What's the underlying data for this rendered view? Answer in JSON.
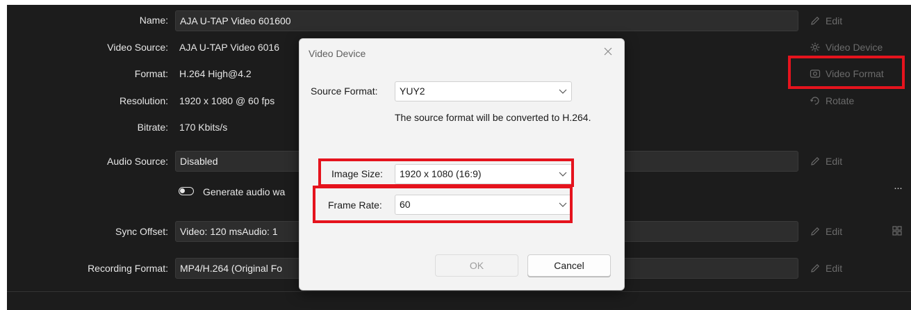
{
  "settings": {
    "name": {
      "label": "Name:",
      "value": "AJA U-TAP Video 601600"
    },
    "video_source": {
      "label": "Video Source:",
      "value": "AJA U-TAP Video 6016"
    },
    "format": {
      "label": "Format:",
      "value": "H.264 High@4.2"
    },
    "resolution": {
      "label": "Resolution:",
      "value": "1920 x 1080 @ 60 fps"
    },
    "bitrate": {
      "label": "Bitrate:",
      "value": "170 Kbits/s"
    },
    "audio_source": {
      "label": "Audio Source:",
      "value": "Disabled"
    },
    "generate_audio": {
      "label": "Generate audio wa"
    },
    "sync_offset": {
      "label": "Sync Offset:",
      "value": "Video: 120 msAudio: 1"
    },
    "recording_format": {
      "label": "Recording Format:",
      "value": "MP4/H.264 (Original Fo"
    }
  },
  "actions": {
    "edit": "Edit",
    "video_device": "Video Device",
    "video_format": "Video Format",
    "rotate": "Rotate",
    "more": "···"
  },
  "dialog": {
    "title": "Video Device",
    "source_format_label": "Source Format:",
    "source_format_value": "YUY2",
    "note": "The source format will be converted to H.264.",
    "image_size_label": "Image Size:",
    "image_size_value": "1920 x 1080 (16:9)",
    "frame_rate_label": "Frame Rate:",
    "frame_rate_value": "60",
    "ok_label": "OK",
    "cancel_label": "Cancel"
  },
  "colors": {
    "highlight": "#e5131d",
    "panel_bg": "#1c1c1c",
    "dialog_bg": "#f3f3f3"
  }
}
